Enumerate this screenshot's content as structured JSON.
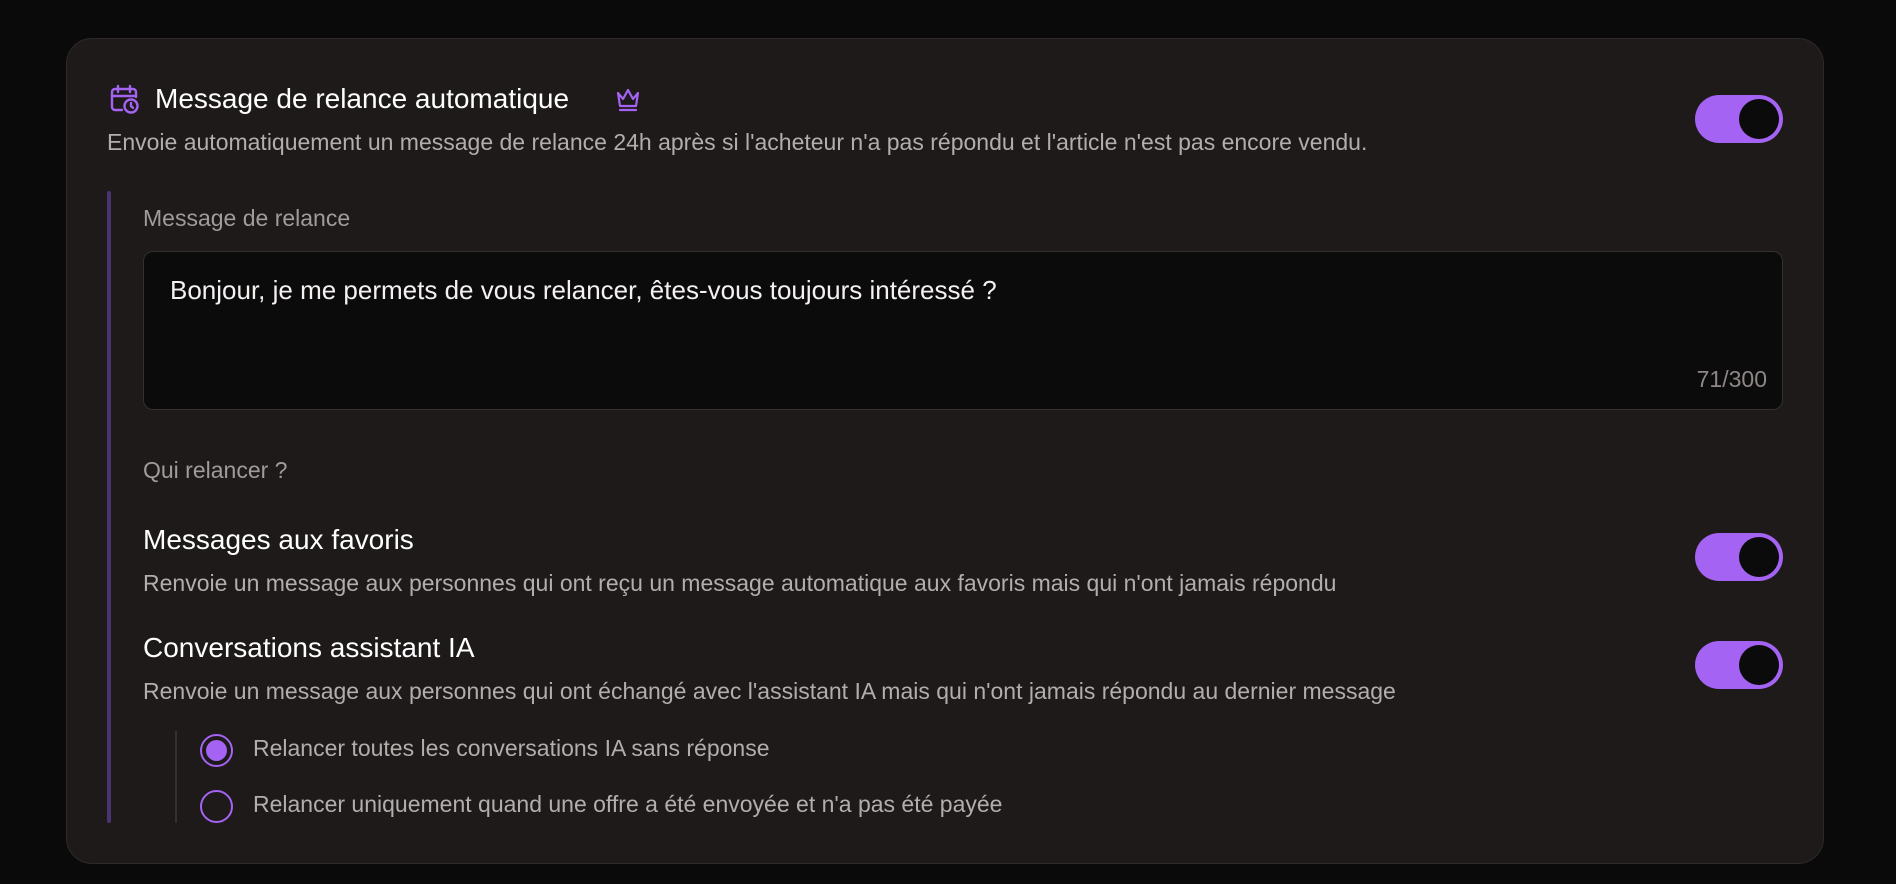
{
  "header": {
    "title": "Message de relance automatique",
    "subtitle": "Envoie automatiquement un message de relance 24h après si l'acheteur n'a pas répondu et l'article n'est pas encore vendu.",
    "toggle_on": true
  },
  "message": {
    "label": "Message de relance",
    "value": "Bonjour, je me permets de vous relancer, êtes-vous toujours intéressé ?",
    "char_count": "71/300"
  },
  "targets": {
    "label": "Qui relancer ?",
    "options": [
      {
        "title": "Messages aux favoris",
        "description": "Renvoie un message aux personnes qui ont reçu un message automatique aux favoris mais qui n'ont jamais répondu",
        "enabled": true
      },
      {
        "title": "Conversations assistant IA",
        "description": "Renvoie un message aux personnes qui ont échangé avec l'assistant IA mais qui n'ont jamais répondu au dernier message",
        "enabled": true
      }
    ],
    "ai_mode": [
      {
        "label": "Relancer toutes les conversations IA sans réponse",
        "selected": true
      },
      {
        "label": "Relancer uniquement quand une offre a été envoyée et n'a pas été payée",
        "selected": false
      }
    ]
  },
  "colors": {
    "accent": "#a463f2",
    "card_bg": "#1d1a19",
    "page_bg": "#0b0a0a"
  },
  "icons": [
    "calendar-clock-icon",
    "crown-icon"
  ]
}
